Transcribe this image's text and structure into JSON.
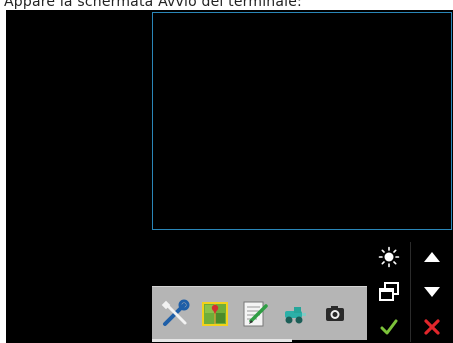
{
  "caption": {
    "text": "Appare la schermata Avvio del terminale:"
  },
  "colors": {
    "screen_bg": "#000000",
    "frame_border": "#2a86b8",
    "taskbar_bg": "#b5b5b5",
    "confirm": "#7cc23a",
    "cancel": "#e2262b"
  },
  "side_controls": [
    {
      "name": "brightness-button",
      "icon": "sun-icon"
    },
    {
      "name": "scroll-up-button",
      "icon": "triangle-up-icon"
    },
    {
      "name": "switch-window-button",
      "icon": "window-switch-icon"
    },
    {
      "name": "scroll-down-button",
      "icon": "triangle-down-icon"
    },
    {
      "name": "confirm-button",
      "icon": "check-icon"
    },
    {
      "name": "cancel-button",
      "icon": "cross-icon"
    }
  ],
  "taskbar_apps": [
    {
      "name": "settings-app-button",
      "icon": "tools-icon"
    },
    {
      "name": "field-map-app-button",
      "icon": "map-icon"
    },
    {
      "name": "notes-app-button",
      "icon": "notepad-icon"
    },
    {
      "name": "vehicle-app-button",
      "icon": "tractor-icon"
    },
    {
      "name": "camera-app-button",
      "icon": "camera-icon"
    }
  ]
}
